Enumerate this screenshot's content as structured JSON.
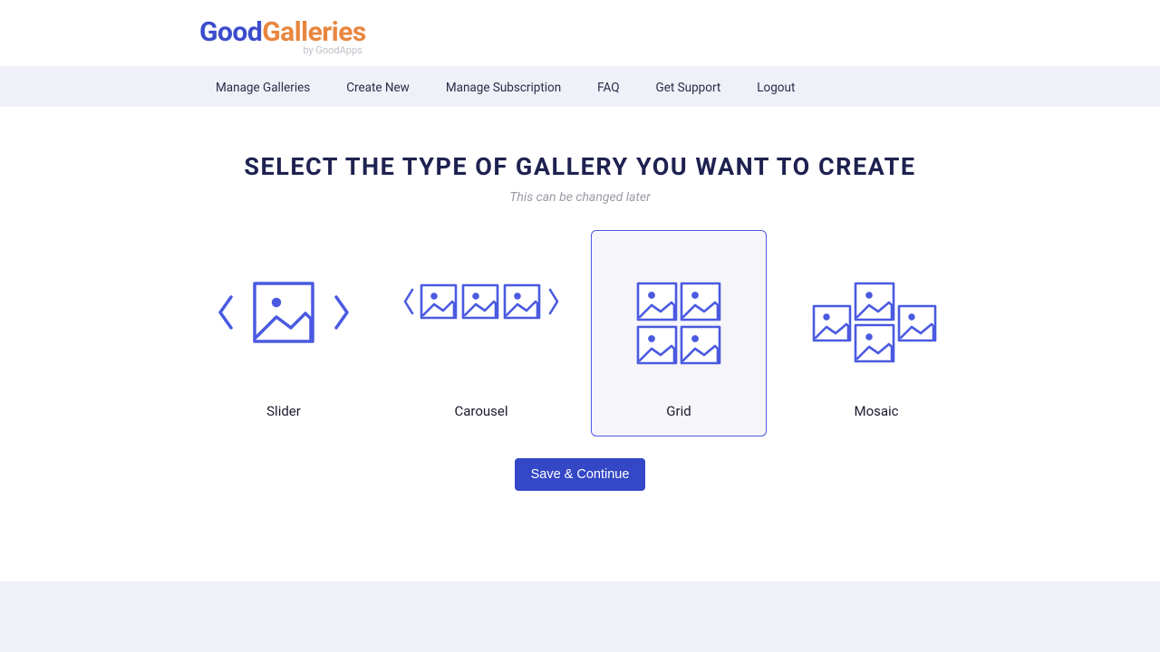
{
  "logo": {
    "part1": "Good",
    "part2": "Galleries",
    "sub": "by GoodApps"
  },
  "nav": {
    "manage_galleries": "Manage Galleries",
    "create_new": "Create New",
    "manage_subscription": "Manage Subscription",
    "faq": "FAQ",
    "get_support": "Get Support",
    "logout": "Logout"
  },
  "main": {
    "title": "SELECT THE TYPE OF GALLERY YOU WANT TO CREATE",
    "subtitle": "This can be changed later",
    "options": {
      "slider": "Slider",
      "carousel": "Carousel",
      "grid": "Grid",
      "mosaic": "Mosaic"
    },
    "selected": "grid",
    "save_label": "Save & Continue"
  },
  "colors": {
    "accent": "#4a5ae0"
  }
}
